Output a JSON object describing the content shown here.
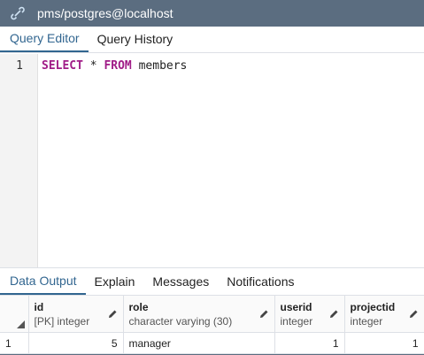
{
  "connection": {
    "title": "pms/postgres@localhost"
  },
  "editor_tabs": [
    {
      "label": "Query Editor",
      "active": true
    },
    {
      "label": "Query History",
      "active": false
    }
  ],
  "editor": {
    "line_number": "1",
    "keyword_select": "SELECT",
    "star": " * ",
    "keyword_from": "FROM",
    "table": " members"
  },
  "output_tabs": [
    {
      "label": "Data Output",
      "active": true
    },
    {
      "label": "Explain",
      "active": false
    },
    {
      "label": "Messages",
      "active": false
    },
    {
      "label": "Notifications",
      "active": false
    }
  ],
  "grid": {
    "columns": [
      {
        "name": "id",
        "type": "[PK] integer"
      },
      {
        "name": "role",
        "type": "character varying (30)"
      },
      {
        "name": "userid",
        "type": "integer"
      },
      {
        "name": "projectid",
        "type": "integer"
      }
    ],
    "rows": [
      {
        "row_num": "1",
        "cells": [
          "5",
          "manager",
          "1",
          "1"
        ]
      }
    ]
  },
  "colors": {
    "topbar": "#5b6d80",
    "active_tab": "#326690",
    "keyword": "#a01c87"
  }
}
